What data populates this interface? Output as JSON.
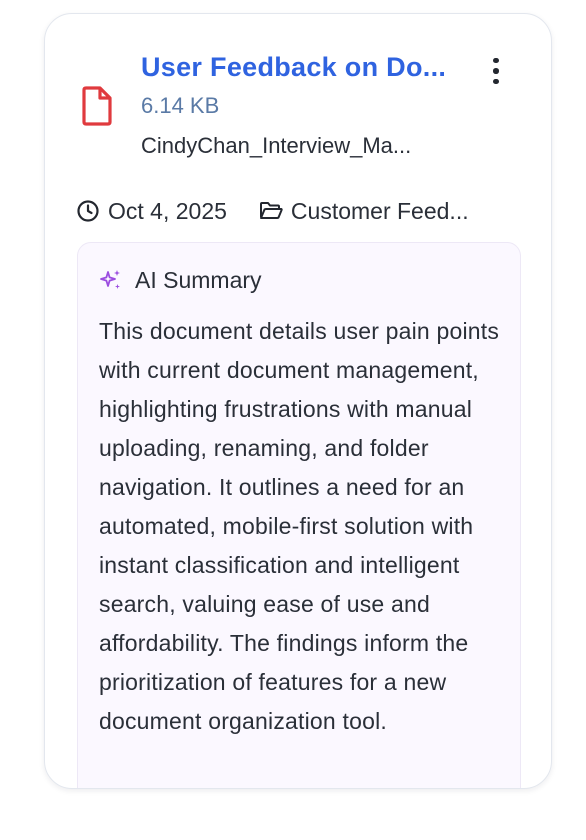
{
  "card": {
    "title": "User Feedback on Do...",
    "file_size": "6.14 KB",
    "file_name": "CindyChan_Interview_Ma...",
    "date": "Oct 4, 2025",
    "folder": "Customer Feed...",
    "icons": {
      "file": "file-icon",
      "more": "more-vertical-icon",
      "clock": "clock-icon",
      "folder": "folder-open-icon",
      "sparkle": "sparkle-icon"
    },
    "colors": {
      "title": "#2f63e0",
      "file_icon": "#e03a3e",
      "size_text": "#5a7aa6",
      "sparkle": "#9b4de0",
      "summary_bg": "#fbf8ff"
    }
  },
  "summary": {
    "heading": "AI Summary",
    "text": "This document details user pain points with current document management, highlighting frustrations with manual uploading, renaming, and folder navigation. It outlines a need for an automated, mobile-first solution with instant classification and intelligent search, valuing ease of use and affordability. The findings inform the prioritization of features for a new document organization tool."
  }
}
